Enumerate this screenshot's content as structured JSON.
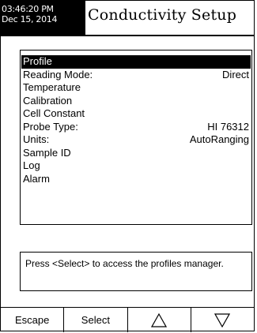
{
  "header": {
    "time": "03:46:20 PM",
    "date": "Dec 15, 2014",
    "title": "Conductivity Setup"
  },
  "menu": {
    "items": [
      {
        "label": "Profile",
        "value": "",
        "selected": true
      },
      {
        "label": "Reading Mode:",
        "value": "Direct",
        "selected": false
      },
      {
        "label": "Temperature",
        "value": "",
        "selected": false
      },
      {
        "label": "Calibration",
        "value": "",
        "selected": false
      },
      {
        "label": "Cell Constant",
        "value": "",
        "selected": false
      },
      {
        "label": "Probe Type:",
        "value": "HI 76312",
        "selected": false
      },
      {
        "label": "Units:",
        "value": "AutoRanging",
        "selected": false
      },
      {
        "label": "Sample ID",
        "value": "",
        "selected": false
      },
      {
        "label": "Log",
        "value": "",
        "selected": false
      },
      {
        "label": "Alarm",
        "value": "",
        "selected": false
      }
    ]
  },
  "help": {
    "text": "Press <Select> to access the profiles manager."
  },
  "softkeys": {
    "escape": "Escape",
    "select": "Select",
    "up_icon": "up-triangle-icon",
    "down_icon": "down-triangle-icon"
  }
}
